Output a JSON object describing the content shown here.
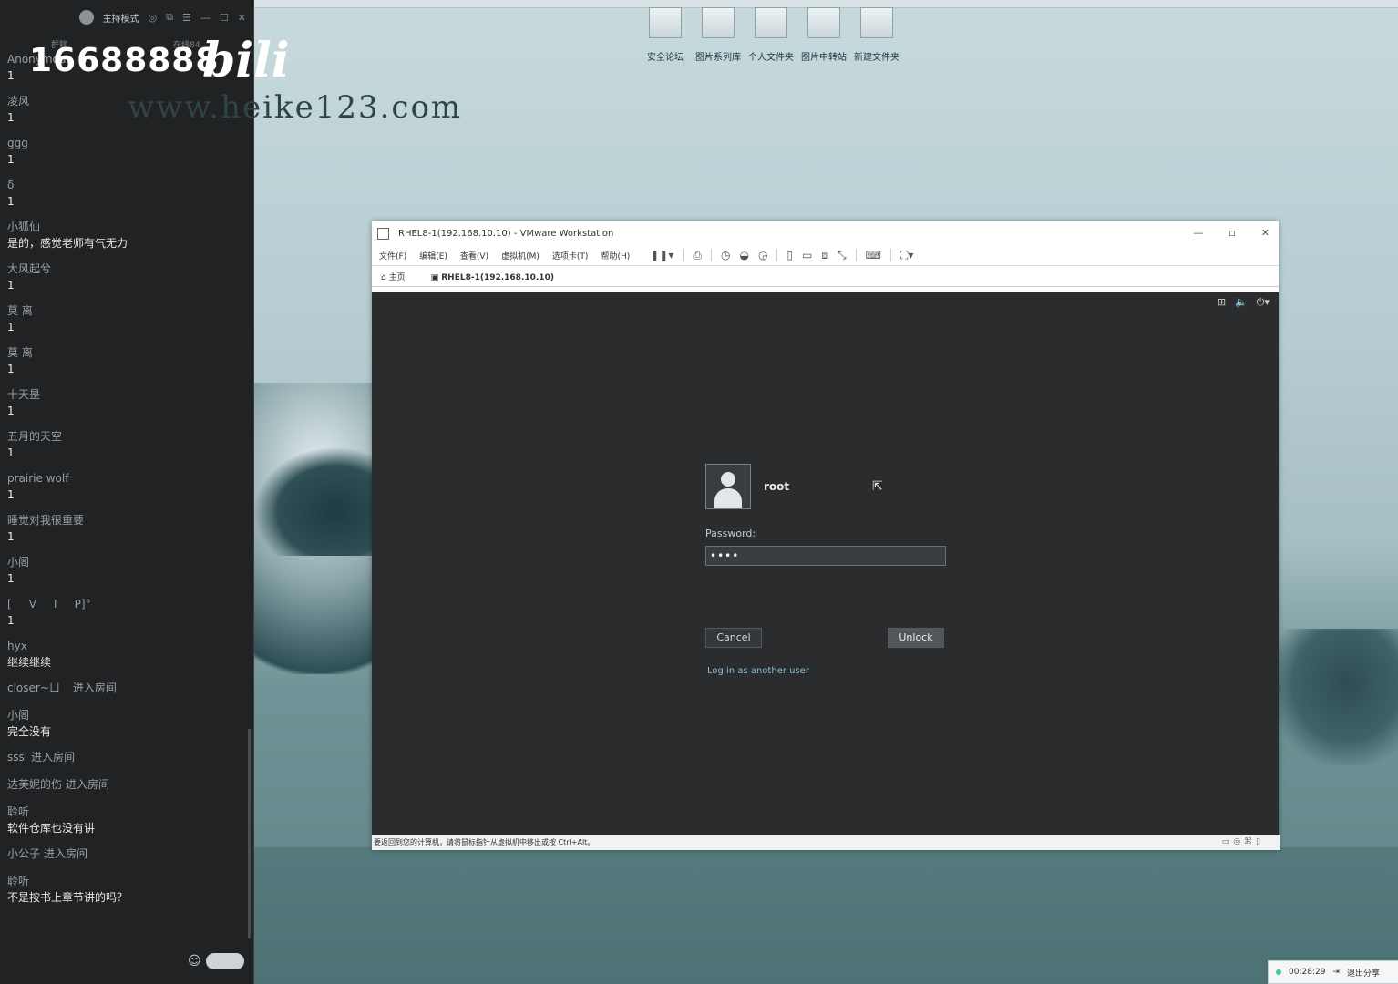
{
  "chat": {
    "title": "主持模式",
    "tab_group": "群聊",
    "tab_online": "在线84",
    "messages": [
      {
        "name": "Anonymous",
        "text": "1"
      },
      {
        "name": "凌风",
        "text": "1"
      },
      {
        "name": "ggg",
        "text": "1"
      },
      {
        "name": "δ",
        "text": "1"
      },
      {
        "name": "小狐仙",
        "text": "是的，感觉老师有气无力"
      },
      {
        "name": "大风起兮",
        "text": "1"
      },
      {
        "name": "莫 离",
        "text": "1"
      },
      {
        "name": "莫 离",
        "text": "1"
      },
      {
        "name": "十天昰",
        "text": "1"
      },
      {
        "name": "五月的天空",
        "text": "1"
      },
      {
        "name": "prairie wolf",
        "text": "1"
      },
      {
        "name": "睡觉对我很重要",
        "text": "1"
      },
      {
        "name": "小阁",
        "text": "1"
      },
      {
        "name": "[     V     I     P]°",
        "text": "1"
      },
      {
        "name": "hyx",
        "text": "继续继续"
      }
    ],
    "enter1": {
      "name": "closer~ㄩ",
      "action": "进入房间"
    },
    "msg_xiaoge2": {
      "name": "小阁",
      "text": "完全没有"
    },
    "enter2": {
      "name": "sssl",
      "action": "进入房间"
    },
    "enter3": {
      "name": "达芙妮的伤",
      "action": "进入房间"
    },
    "msg_lingting1": {
      "name": "聆听",
      "text": "软件仓库也没有讲"
    },
    "enter4": {
      "name": "小公子",
      "action": "进入房间"
    },
    "msg_lingting2": {
      "name": "聆听",
      "text": "不是按书上章节讲的吗？"
    }
  },
  "watermark": {
    "number": "16688888",
    "logo": "bili",
    "url": "www.heike123.com"
  },
  "desktop_icons": [
    "安全论坛",
    "图片系列库",
    "个人文件夹",
    "图片中转站",
    "新建文件夹"
  ],
  "vmware": {
    "title": "RHEL8-1(192.168.10.10) - VMware Workstation",
    "menu": [
      "文件(F)",
      "编辑(E)",
      "查看(V)",
      "虚拟机(M)",
      "选项卡(T)",
      "帮助(H)"
    ],
    "tabs": {
      "home": "主页",
      "vm": "RHEL8-1(192.168.10.10)"
    },
    "status_text": "要返回到您的计算机，请将鼠标指针从虚拟机中移出或按 Ctrl+Alt。"
  },
  "lock_screen": {
    "username": "root",
    "password_label": "Password:",
    "password_value": "••••",
    "cancel_label": "Cancel",
    "unlock_label": "Unlock",
    "another_user_label": "Log in as another user"
  },
  "share_bar": {
    "time": "00:28:29",
    "exit_label": "退出分享"
  }
}
